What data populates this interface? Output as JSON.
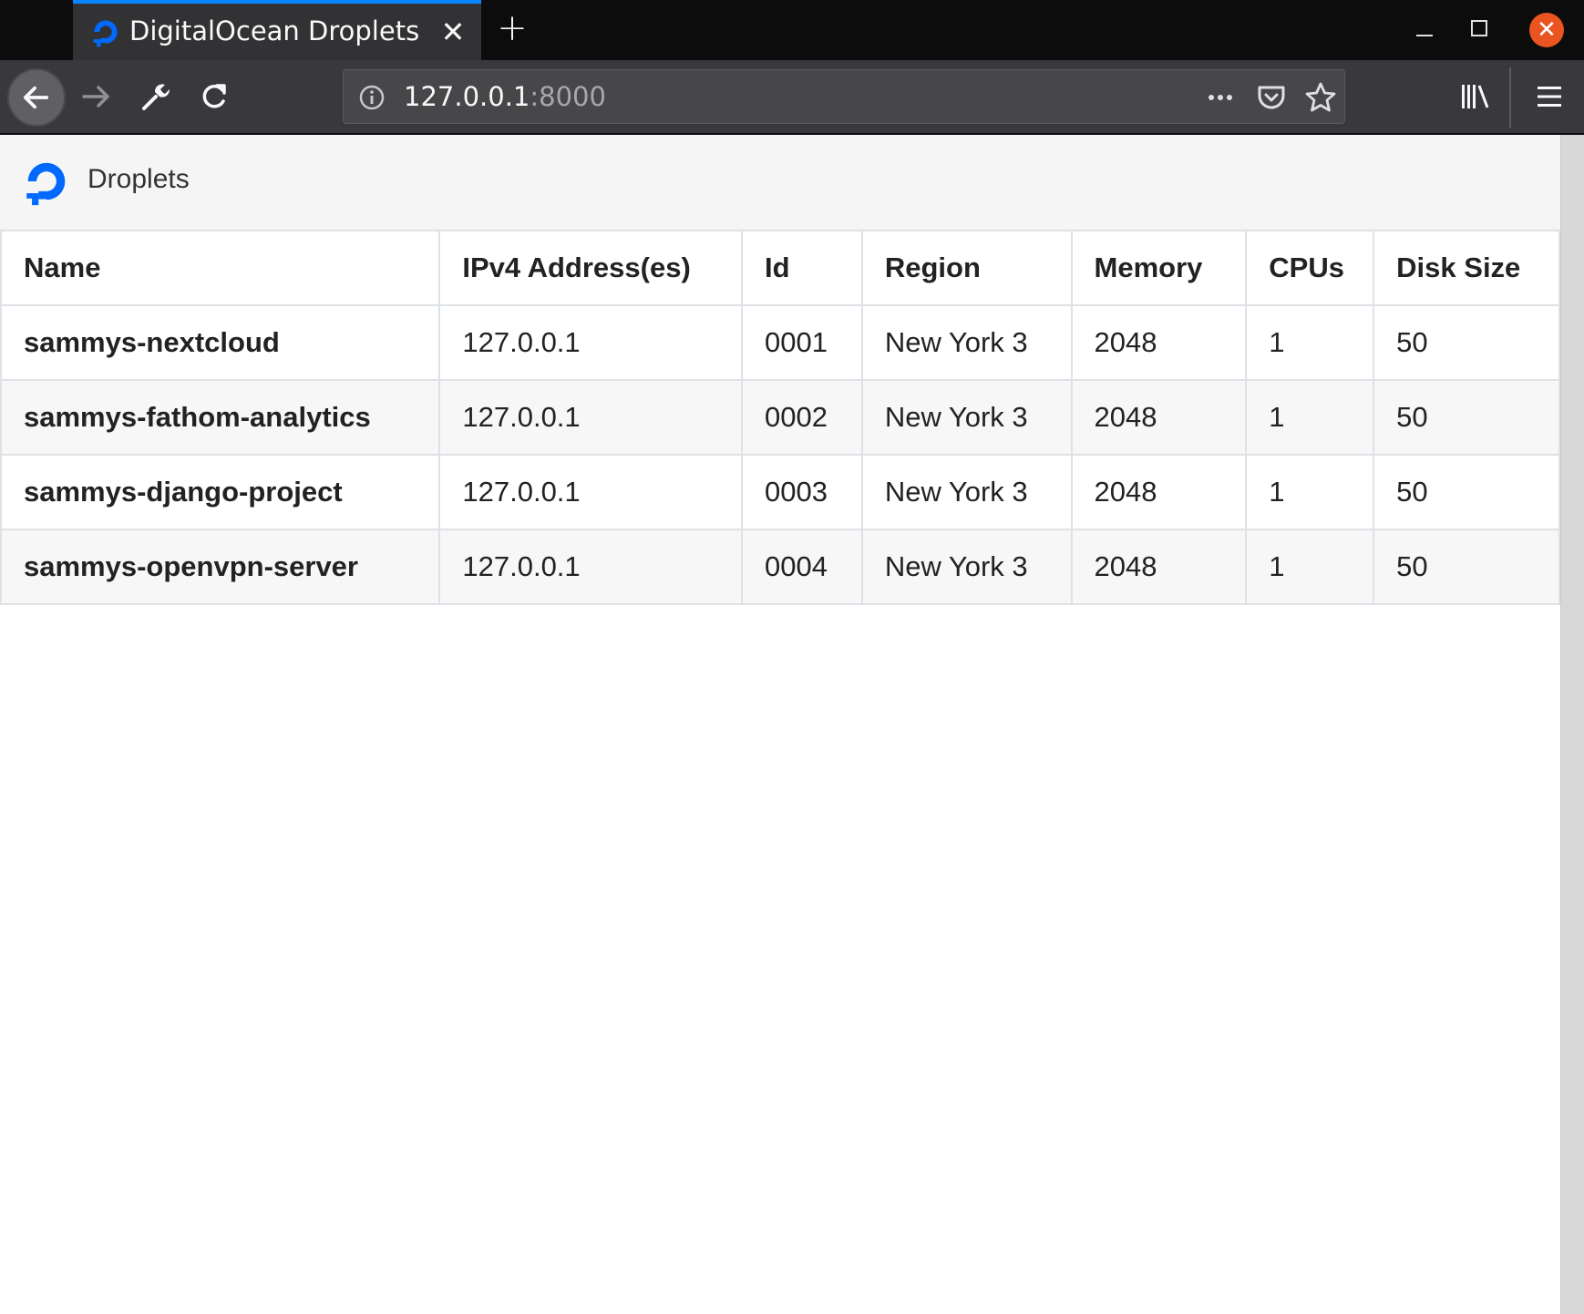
{
  "browser": {
    "tab": {
      "title": "DigitalOcean Droplets",
      "favicon": "digitalocean-logo-icon"
    },
    "url": {
      "host": "127.0.0.1",
      "port": ":8000"
    },
    "colors": {
      "accent": "#0a84ff",
      "close": "#e95420",
      "brand": "#0069ff"
    }
  },
  "page": {
    "title": "Droplets",
    "table": {
      "headers": [
        "Name",
        "IPv4 Address(es)",
        "Id",
        "Region",
        "Memory",
        "CPUs",
        "Disk Size"
      ],
      "rows": [
        [
          "sammys-nextcloud",
          "127.0.0.1",
          "0001",
          "New York 3",
          "2048",
          "1",
          "50"
        ],
        [
          "sammys-fathom-analytics",
          "127.0.0.1",
          "0002",
          "New York 3",
          "2048",
          "1",
          "50"
        ],
        [
          "sammys-django-project",
          "127.0.0.1",
          "0003",
          "New York 3",
          "2048",
          "1",
          "50"
        ],
        [
          "sammys-openvpn-server",
          "127.0.0.1",
          "0004",
          "New York 3",
          "2048",
          "1",
          "50"
        ]
      ]
    }
  }
}
